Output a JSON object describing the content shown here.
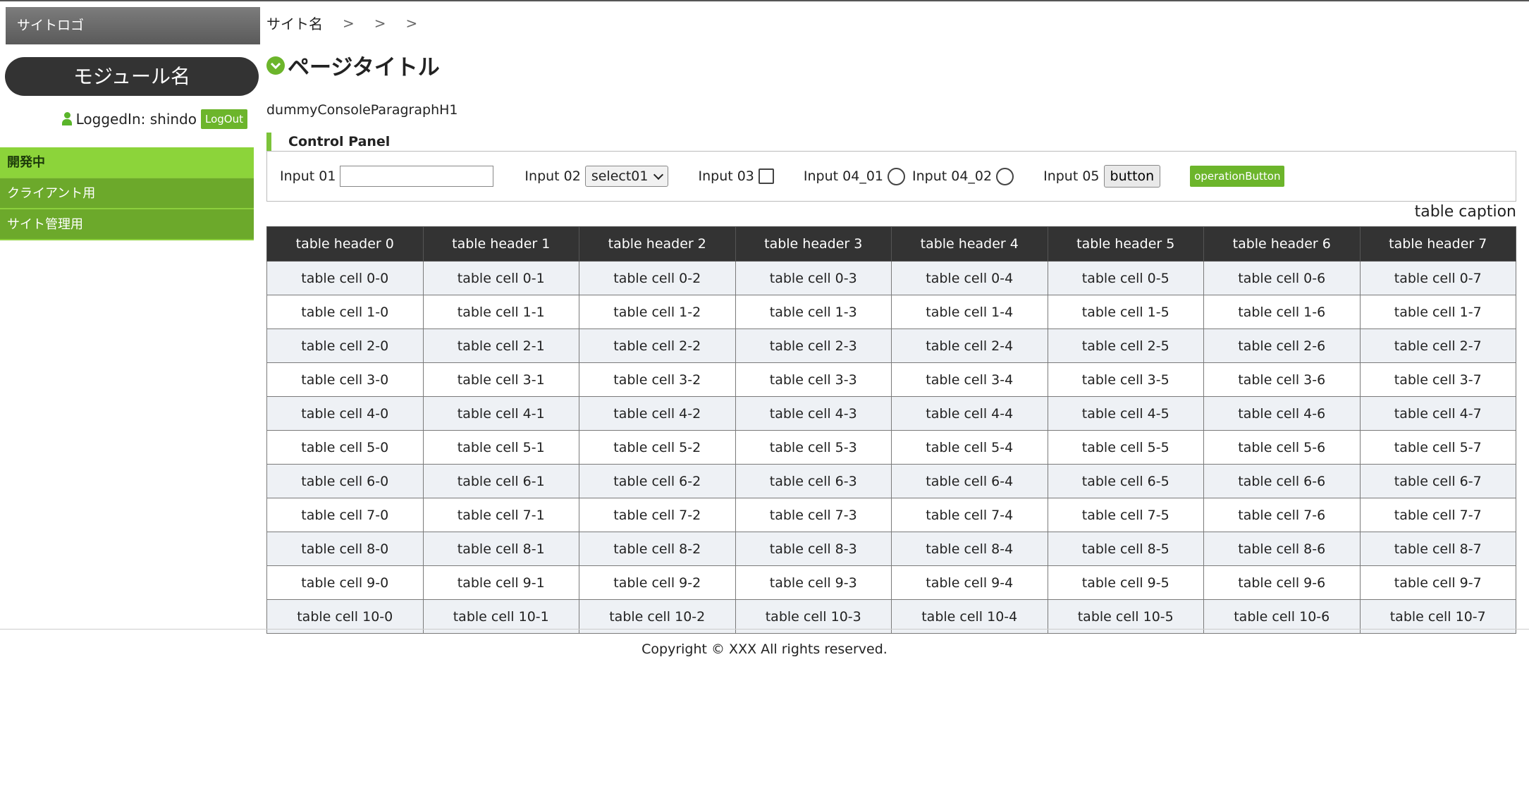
{
  "sidebar": {
    "logo": "サイトロゴ",
    "module_name": "モジュール名",
    "login_text": "LoggedIn: shindo",
    "logout_label": "LogOut",
    "items": [
      {
        "label": "開発中",
        "active": true
      },
      {
        "label": "クライアント用",
        "active": false
      },
      {
        "label": "サイト管理用",
        "active": false
      }
    ]
  },
  "breadcrumb": {
    "site_name": "サイト名",
    "separator": ">"
  },
  "page": {
    "title": "ページタイトル",
    "paragraph": "dummyConsoleParagraphH1"
  },
  "control_panel": {
    "heading": "Control Panel",
    "input01_label": "Input 01",
    "input01_value": "",
    "input02_label": "Input 02",
    "input02_selected": "select01",
    "input03_label": "Input 03",
    "input04_01_label": "Input 04_01",
    "input04_02_label": "Input 04_02",
    "input05_label": "Input 05",
    "input05_button": "button",
    "operation_button": "operationButton"
  },
  "table": {
    "caption": "table caption",
    "headers": [
      "table header 0",
      "table header 1",
      "table header 2",
      "table header 3",
      "table header 4",
      "table header 5",
      "table header 6",
      "table header 7"
    ],
    "rows": [
      [
        "table cell 0-0",
        "table cell 0-1",
        "table cell 0-2",
        "table cell 0-3",
        "table cell 0-4",
        "table cell 0-5",
        "table cell 0-6",
        "table cell 0-7"
      ],
      [
        "table cell 1-0",
        "table cell 1-1",
        "table cell 1-2",
        "table cell 1-3",
        "table cell 1-4",
        "table cell 1-5",
        "table cell 1-6",
        "table cell 1-7"
      ],
      [
        "table cell 2-0",
        "table cell 2-1",
        "table cell 2-2",
        "table cell 2-3",
        "table cell 2-4",
        "table cell 2-5",
        "table cell 2-6",
        "table cell 2-7"
      ],
      [
        "table cell 3-0",
        "table cell 3-1",
        "table cell 3-2",
        "table cell 3-3",
        "table cell 3-4",
        "table cell 3-5",
        "table cell 3-6",
        "table cell 3-7"
      ],
      [
        "table cell 4-0",
        "table cell 4-1",
        "table cell 4-2",
        "table cell 4-3",
        "table cell 4-4",
        "table cell 4-5",
        "table cell 4-6",
        "table cell 4-7"
      ],
      [
        "table cell 5-0",
        "table cell 5-1",
        "table cell 5-2",
        "table cell 5-3",
        "table cell 5-4",
        "table cell 5-5",
        "table cell 5-6",
        "table cell 5-7"
      ],
      [
        "table cell 6-0",
        "table cell 6-1",
        "table cell 6-2",
        "table cell 6-3",
        "table cell 6-4",
        "table cell 6-5",
        "table cell 6-6",
        "table cell 6-7"
      ],
      [
        "table cell 7-0",
        "table cell 7-1",
        "table cell 7-2",
        "table cell 7-3",
        "table cell 7-4",
        "table cell 7-5",
        "table cell 7-6",
        "table cell 7-7"
      ],
      [
        "table cell 8-0",
        "table cell 8-1",
        "table cell 8-2",
        "table cell 8-3",
        "table cell 8-4",
        "table cell 8-5",
        "table cell 8-6",
        "table cell 8-7"
      ],
      [
        "table cell 9-0",
        "table cell 9-1",
        "table cell 9-2",
        "table cell 9-3",
        "table cell 9-4",
        "table cell 9-5",
        "table cell 9-6",
        "table cell 9-7"
      ],
      [
        "table cell 10-0",
        "table cell 10-1",
        "table cell 10-2",
        "table cell 10-3",
        "table cell 10-4",
        "table cell 10-5",
        "table cell 10-6",
        "table cell 10-7"
      ]
    ]
  },
  "footer": {
    "copyright": "Copyright © XXX All rights reserved."
  },
  "colors": {
    "accent": "#6cb52b",
    "nav_active": "#8cd43a",
    "header_dark": "#333333"
  }
}
